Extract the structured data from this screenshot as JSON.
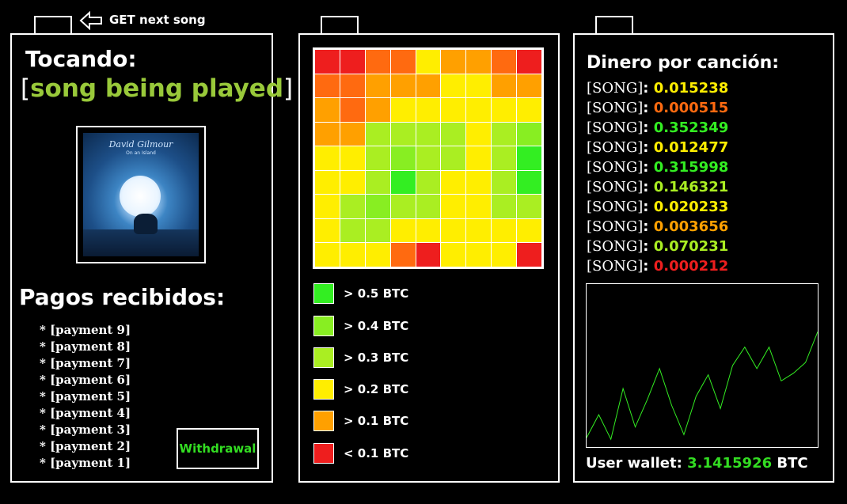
{
  "header": {
    "next_song_label": "GET next song"
  },
  "now_playing": {
    "heading": "Tocando:",
    "song_title": "song being played",
    "album_artist": "David Gilmour",
    "album_subtitle": "On an Island"
  },
  "payments": {
    "heading": "Pagos recibidos:",
    "items": [
      "* [payment 9]",
      "* [payment 8]",
      "* [payment 7]",
      "* [payment 6]",
      "* [payment 5]",
      "* [payment 4]",
      "* [payment 3]",
      "* [payment 2]",
      "* [payment 1]"
    ],
    "withdraw_label": "Withdrawal"
  },
  "heatmap": {
    "colors": {
      "g5": "#33ee22",
      "g4": "#88ee22",
      "g3": "#aaee22",
      "y2": "#ffee00",
      "o1": "#ffa000",
      "r0": "#ee1e1e",
      "do": "#ff6a10"
    },
    "grid": [
      [
        "r0",
        "r0",
        "do",
        "do",
        "y2",
        "o1",
        "o1",
        "do",
        "r0"
      ],
      [
        "do",
        "do",
        "o1",
        "o1",
        "o1",
        "y2",
        "y2",
        "o1",
        "o1"
      ],
      [
        "o1",
        "do",
        "o1",
        "y2",
        "y2",
        "y2",
        "y2",
        "y2",
        "y2"
      ],
      [
        "o1",
        "o1",
        "g3",
        "g3",
        "g3",
        "g3",
        "y2",
        "g3",
        "g4"
      ],
      [
        "y2",
        "y2",
        "g3",
        "g4",
        "g3",
        "g3",
        "y2",
        "g3",
        "g5"
      ],
      [
        "y2",
        "y2",
        "g3",
        "g5",
        "g3",
        "y2",
        "y2",
        "g3",
        "g5"
      ],
      [
        "y2",
        "g3",
        "g4",
        "g3",
        "g3",
        "y2",
        "y2",
        "g3",
        "g3"
      ],
      [
        "y2",
        "g3",
        "g3",
        "y2",
        "y2",
        "y2",
        "y2",
        "y2",
        "y2"
      ],
      [
        "y2",
        "y2",
        "y2",
        "do",
        "r0",
        "y2",
        "y2",
        "y2",
        "r0"
      ]
    ],
    "legend": [
      {
        "label": "> 0.5 BTC",
        "color": "#33ee22"
      },
      {
        "label": "> 0.4 BTC",
        "color": "#88ee22"
      },
      {
        "label": "> 0.3 BTC",
        "color": "#aaee22"
      },
      {
        "label": "> 0.2 BTC",
        "color": "#ffee00"
      },
      {
        "label": "> 0.1 BTC",
        "color": "#ffa000"
      },
      {
        "label": "< 0.1 BTC",
        "color": "#ee1e1e"
      }
    ]
  },
  "earnings": {
    "heading": "Dinero por canción:",
    "songs": [
      {
        "tag": "[SONG]",
        "sep": ": ",
        "value": "0.015238",
        "color": "#ffee00"
      },
      {
        "tag": "[SONG]",
        "sep": ": ",
        "value": "0.000515",
        "color": "#ff6a10"
      },
      {
        "tag": "[SONG]",
        "sep": ": ",
        "value": "0.352349",
        "color": "#33ee22"
      },
      {
        "tag": "[SONG]",
        "sep": ": ",
        "value": "0.012477",
        "color": "#ffee00"
      },
      {
        "tag": "[SONG]",
        "sep": ": ",
        "value": "0.315998",
        "color": "#33ee22"
      },
      {
        "tag": "[SONG]",
        "sep": ": ",
        "value": "0.146321",
        "color": "#aaee22"
      },
      {
        "tag": "[SONG]",
        "sep": ": ",
        "value": "0.020233",
        "color": "#ffee00"
      },
      {
        "tag": "[SONG]",
        "sep": ": ",
        "value": "0.003656",
        "color": "#ffa000"
      },
      {
        "tag": "[SONG]",
        "sep": ": ",
        "value": "0.070231",
        "color": "#aaee22"
      },
      {
        "tag": "[SONG]",
        "sep": ": ",
        "value": "0.000212",
        "color": "#ee1e1e"
      }
    ],
    "wallet_label": "User wallet:",
    "wallet_amount": "3.1415926",
    "wallet_unit": "BTC",
    "line_color": "#33ee22"
  },
  "chart_data": {
    "type": "line",
    "title": "",
    "xlabel": "",
    "ylabel": "",
    "x": [
      0,
      1,
      2,
      3,
      4,
      5,
      6,
      7,
      8,
      9,
      10,
      11,
      12,
      13,
      14,
      15,
      16,
      17,
      18,
      19
    ],
    "series": [
      {
        "values": [
          3,
          18,
          2,
          35,
          10,
          28,
          48,
          24,
          5,
          30,
          44,
          22,
          50,
          62,
          48,
          62,
          40,
          45,
          52,
          72
        ]
      }
    ],
    "ylim": [
      0,
      100
    ],
    "grid": false
  }
}
